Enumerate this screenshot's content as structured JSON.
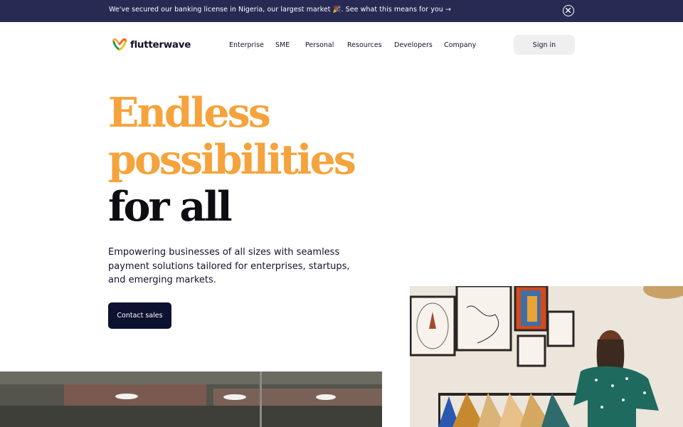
{
  "announcement": {
    "text": "We've secured our banking license in Nigeria, our largest market 🎉. See what this means for you →",
    "close_icon": "close-circle-icon"
  },
  "header": {
    "logo_text": "flutterwave",
    "logo_icon": "flutterwave-heart-logo",
    "nav": [
      "Enterprise",
      "SME",
      "Personal",
      "Resources",
      "Developers",
      "Company"
    ],
    "signin_label": "Sign in"
  },
  "hero": {
    "line1": "Endless",
    "line2": "possibilities",
    "line3": "for all",
    "subtitle": "Empowering businesses of all sizes with seamless payment solutions tailored for enterprises, startups, and emerging markets.",
    "cta_label": "Contact sales"
  },
  "colors": {
    "announcement_bg": "#272b54",
    "accent_orange": "#f5a33c",
    "heading_dark": "#0d0d12",
    "cta_bg": "#0d1230",
    "signin_bg": "#efeff0"
  }
}
